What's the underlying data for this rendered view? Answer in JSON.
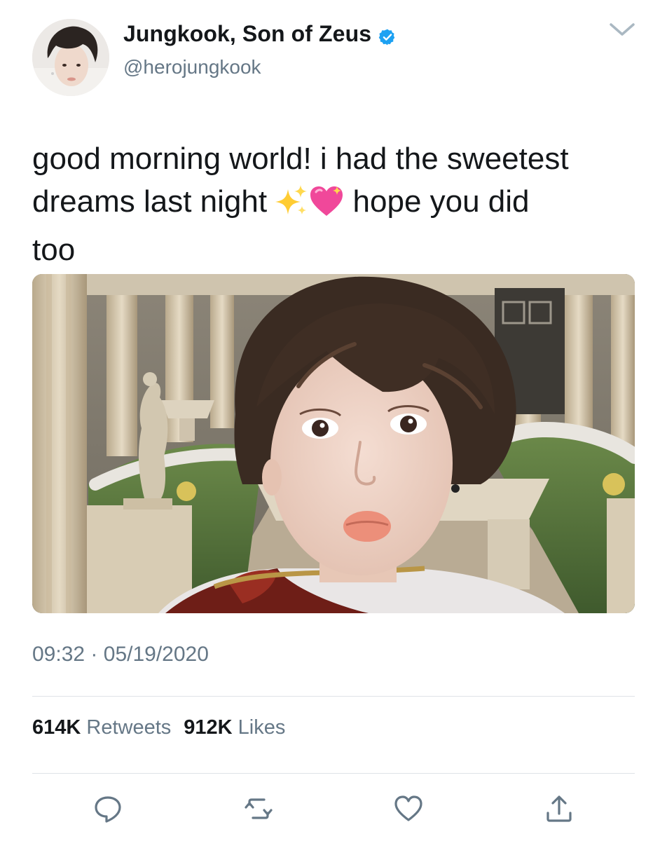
{
  "author": {
    "display_name": "Jungkook, Son of Zeus",
    "handle": "@herojungkook",
    "verified": true,
    "avatar": "avatar-photo"
  },
  "tweet": {
    "text_line1": "good morning world! i had the sweetest",
    "text_line2_a": "dreams last night",
    "text_line2_b": "hope you did",
    "text_line3": "too",
    "emojis": [
      "sparkles-emoji",
      "sparkling-heart-emoji"
    ],
    "media": "photo-selfie-in-greek-courtyard",
    "time": "09:32",
    "separator": "·",
    "date": "05/19/2020"
  },
  "stats": {
    "retweets_count": "614K",
    "retweets_label": "Retweets",
    "likes_count": "912K",
    "likes_label": "Likes"
  },
  "actions": [
    "reply-icon",
    "retweet-icon",
    "like-icon",
    "share-icon"
  ],
  "colors": {
    "text": "#14171a",
    "secondary": "#657786",
    "verified": "#1da1f2",
    "divider": "#dfe3e7"
  }
}
